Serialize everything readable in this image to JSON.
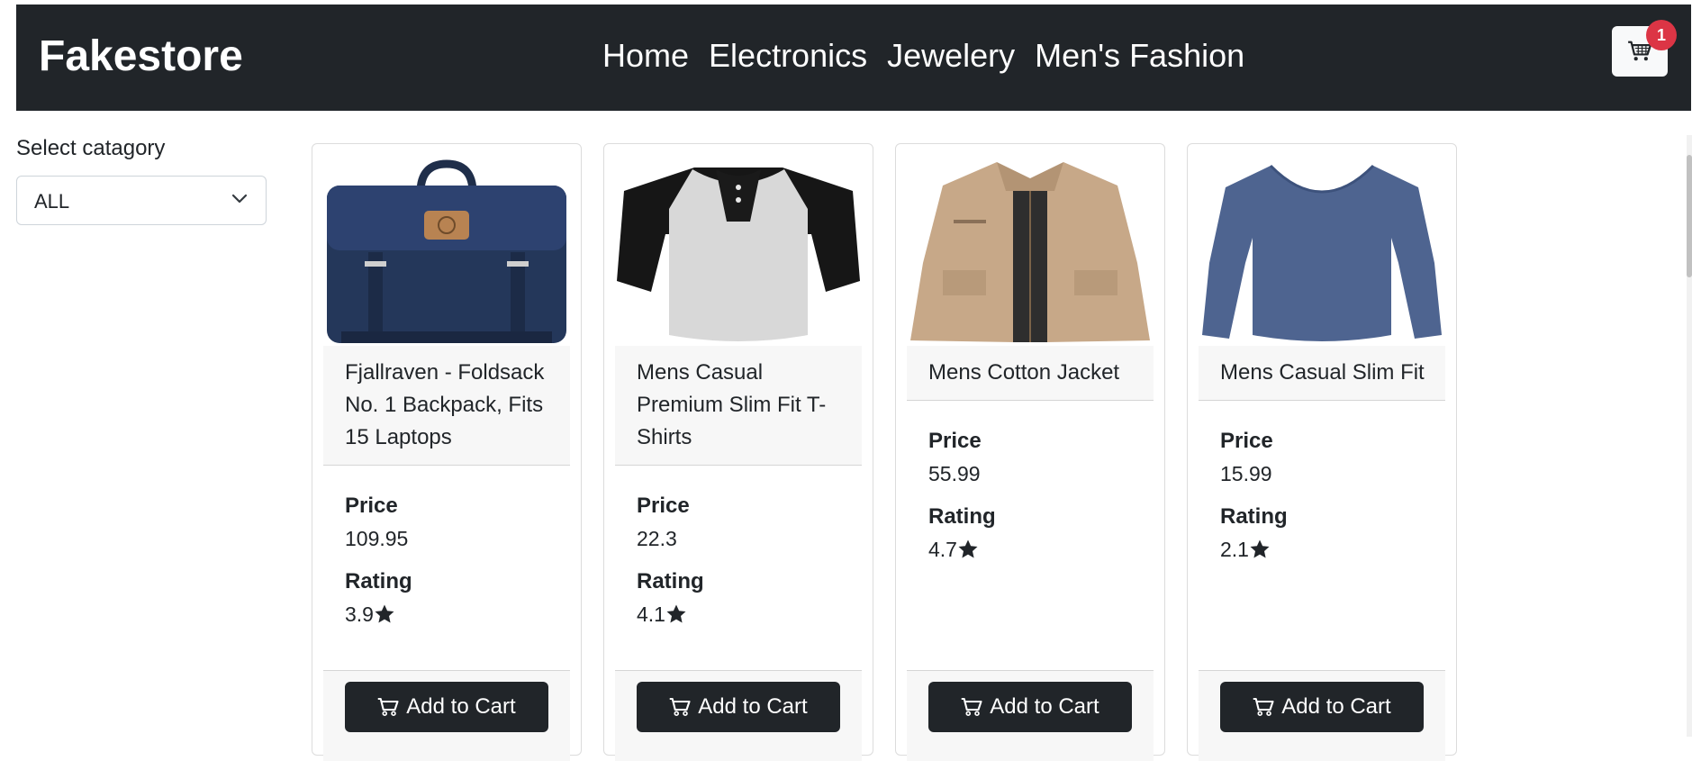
{
  "navbar": {
    "brand": "Fakestore",
    "links": [
      "Home",
      "Electronics",
      "Jewelery",
      "Men's Fashion"
    ],
    "cart_count": "1"
  },
  "sidebar": {
    "label": "Select catagory",
    "selected": "ALL"
  },
  "products": [
    {
      "title": "Fjallraven - Foldsack No. 1 Backpack, Fits 15 Laptops",
      "price_label": "Price",
      "price": "109.95",
      "rating_label": "Rating",
      "rating": "3.9",
      "button": "Add to Cart",
      "image_icon": "backpack-image"
    },
    {
      "title": "Mens Casual Premium Slim Fit T-Shirts",
      "price_label": "Price",
      "price": "22.3",
      "rating_label": "Rating",
      "rating": "4.1",
      "button": "Add to Cart",
      "image_icon": "tshirt-image"
    },
    {
      "title": "Mens Cotton Jacket",
      "price_label": "Price",
      "price": "55.99",
      "rating_label": "Rating",
      "rating": "4.7",
      "button": "Add to Cart",
      "image_icon": "jacket-image"
    },
    {
      "title": "Mens Casual Slim Fit",
      "price_label": "Price",
      "price": "15.99",
      "rating_label": "Rating",
      "rating": "2.1",
      "button": "Add to Cart",
      "image_icon": "longsleeve-image"
    }
  ],
  "colors": {
    "navbar": "#212529",
    "badge": "#dc3545",
    "button": "#212529",
    "card_section": "#f7f7f7"
  },
  "icons": {
    "cart": "cart-icon",
    "star": "star-icon",
    "chevron": "chevron-down-icon"
  }
}
